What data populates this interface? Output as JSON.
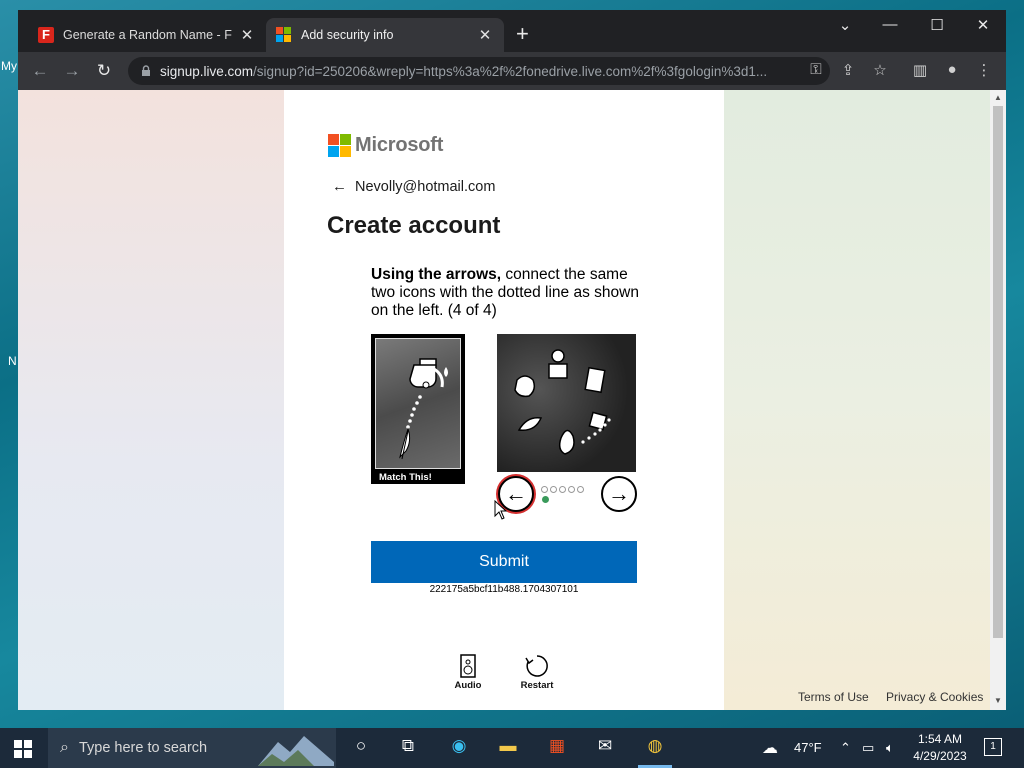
{
  "desktop": {
    "labels": [
      "My",
      "N"
    ]
  },
  "tabs": [
    {
      "title": "Generate a Random Name - Fake",
      "close": "✕"
    },
    {
      "title": "Add security info",
      "close": "✕"
    }
  ],
  "new_tab_label": "+",
  "window_controls": {
    "dropdown": "⌄",
    "minimize": "—",
    "maximize": "☐",
    "close": "✕"
  },
  "address_bar": {
    "host": "signup.live.com",
    "path": "/signup?id=250206&wreply=https%3a%2f%2fonedrive.live.com%2f%3fgologin%3d1..."
  },
  "page": {
    "brand": "Microsoft",
    "back_email": "Nevolly@hotmail.com",
    "heading": "Create account",
    "instructions_bold": "Using the arrows,",
    "instructions_rest": " connect the same two icons with the dotted line as shown on the left. (4 of 4)",
    "match_label": "Match This!",
    "submit_label": "Submit",
    "token": "222175a5bcf11b488.1704307101",
    "audio_label": "Audio",
    "restart_label": "Restart",
    "terms_label": "Terms of Use",
    "privacy_label": "Privacy & Cookies",
    "carousel": {
      "total": 5,
      "current": 1
    }
  },
  "taskbar": {
    "search_placeholder": "Type here to search",
    "weather": "47°F",
    "time": "1:54 AM",
    "date": "4/29/2023",
    "notifications": "1"
  },
  "colors": {
    "ms_red": "#f25022",
    "ms_green": "#7fba00",
    "ms_blue": "#00a4ef",
    "ms_yellow": "#ffb900",
    "submit_blue": "#0067b8",
    "chrome_dark": "#202124"
  }
}
